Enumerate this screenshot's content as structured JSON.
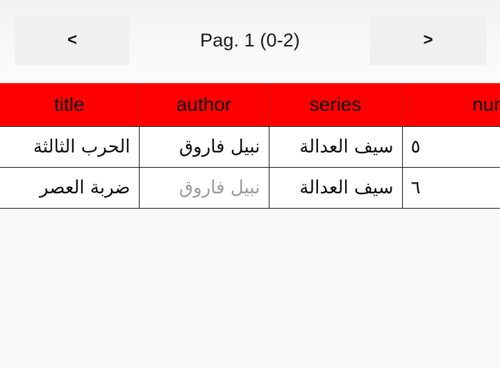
{
  "pager": {
    "prev_label": "<",
    "next_label": ">",
    "status_text": "Pag. 1 (0-2)"
  },
  "table": {
    "header_bg": "#ff0000",
    "columns": [
      {
        "key": "title",
        "label": "title",
        "align": "rtl"
      },
      {
        "key": "author",
        "label": "author",
        "align": "rtl"
      },
      {
        "key": "series",
        "label": "series",
        "align": "rtl"
      },
      {
        "key": "numero",
        "label": "numer",
        "align": "num"
      }
    ],
    "rows": [
      {
        "title": "الحرب الثالثة",
        "author": "نبيل فاروق",
        "series": "سيف العدالة",
        "numero": "٥"
      },
      {
        "title": "ضربة العصر",
        "author": "نبيل فاروق",
        "series": "سيف العدالة",
        "numero": "٦"
      }
    ]
  }
}
